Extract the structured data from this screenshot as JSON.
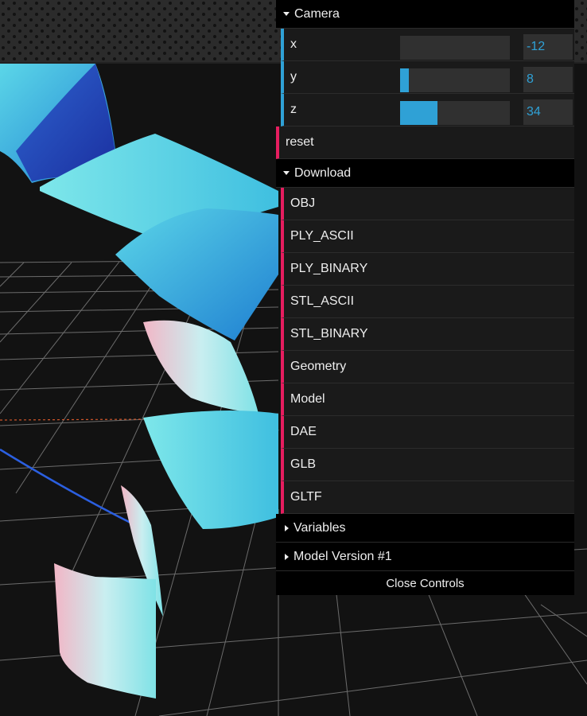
{
  "camera": {
    "title": "Camera",
    "fields": [
      {
        "label": "x",
        "value": "-12",
        "fill_fraction": 0.0
      },
      {
        "label": "y",
        "value": "8",
        "fill_fraction": 0.08
      },
      {
        "label": "z",
        "value": "34",
        "fill_fraction": 0.34
      }
    ],
    "reset_label": "reset"
  },
  "download": {
    "title": "Download",
    "items": [
      "OBJ",
      "PLY_ASCII",
      "PLY_BINARY",
      "STL_ASCII",
      "STL_BINARY",
      "Geometry",
      "Model",
      "DAE",
      "GLB",
      "GLTF"
    ]
  },
  "variables": {
    "title": "Variables"
  },
  "model_version": {
    "title": "Model Version #1"
  },
  "close_label": "Close Controls",
  "colors": {
    "accent": "#2fa1d6",
    "function": "#e61d5f",
    "panel": "#1a1a1a"
  }
}
